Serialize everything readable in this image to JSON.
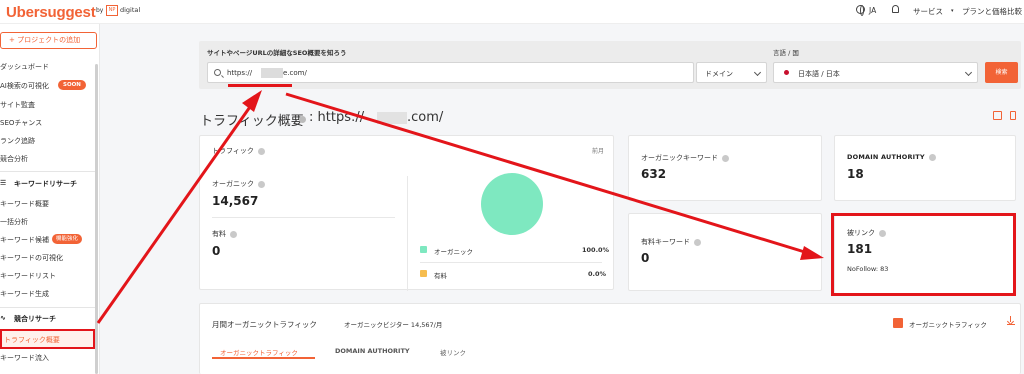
{
  "header": {
    "logo": "Ubersuggest",
    "by": "by",
    "partner_mark": "NP",
    "partner_name": "digital",
    "language": "JA",
    "services": "サービス",
    "pricing": "プランと価格比較"
  },
  "sidebar": {
    "add_project": "+ プロジェクトの追加",
    "items_top": [
      "ダッシュボード",
      "AI検索の可視化",
      "サイト監査",
      "SEOチャンス",
      "ランク追跡",
      "競合分析"
    ],
    "soon_badge": "SOON",
    "keyword_section": "キーワードリサーチ",
    "keyword_items": [
      "キーワード概要",
      "一括分析",
      "キーワード候補",
      "キーワードの可視化",
      "キーワードリスト",
      "キーワード生成"
    ],
    "feature_badge": "機能強化",
    "competitor_section": "競合リサーチ",
    "competitor_items": [
      "トラフィック概要",
      "キーワード流入"
    ]
  },
  "search": {
    "label": "サイトやページURLの詳細なSEO概要を知ろう",
    "url_prefix": "https://",
    "url_suffix": "e.com/",
    "scope": "ドメイン",
    "lang_label": "言語 / 国",
    "lang_value": "日本語 / 日本",
    "button": "検索"
  },
  "page": {
    "title_prefix": "トラフィック概要",
    "title_url_prefix": ": https://",
    "title_url_suffix": ".com/"
  },
  "traffic": {
    "label": "トラフィック",
    "period": "前月",
    "organic_label": "オーガニック",
    "organic_value": "14,567",
    "paid_label": "有料",
    "paid_value": "0",
    "legend": [
      {
        "label": "オーガニック",
        "pct": "100.0%",
        "color": "#7ee8c0"
      },
      {
        "label": "有料",
        "pct": "0.0%",
        "color": "#f6bd4f"
      }
    ]
  },
  "metrics": {
    "organic_kw_label": "オーガニックキーワード",
    "organic_kw_value": "632",
    "domain_authority_label": "DOMAIN AUTHORITY",
    "domain_authority_value": "18",
    "paid_kw_label": "有料キーワード",
    "paid_kw_value": "0",
    "backlinks_label": "被リンク",
    "backlinks_value": "181",
    "nofollow": "NoFollow: 83"
  },
  "monthly": {
    "title": "月間オーガニックトラフィック",
    "visitors": "オーガニックビジター 14,567/月",
    "legend": "オーガニックトラフィック",
    "tabs": [
      "オーガニックトラフィック",
      "DOMAIN AUTHORITY",
      "被リンク"
    ]
  },
  "colors": {
    "accent": "#f26336",
    "annotation_red": "#e3151a",
    "organic_green": "#7ee8c0",
    "paid_yellow": "#f6bd4f"
  }
}
